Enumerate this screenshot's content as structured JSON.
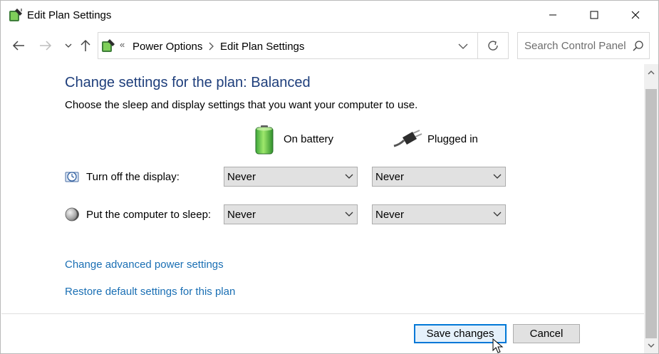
{
  "window": {
    "title": "Edit Plan Settings",
    "icon": "power-options-icon"
  },
  "navigation": {
    "breadcrumb": [
      "Power Options",
      "Edit Plan Settings"
    ],
    "breadcrumb_overflow": "«",
    "search_placeholder": "Search Control Panel"
  },
  "main": {
    "heading": "Change settings for the plan: Balanced",
    "description": "Choose the sleep and display settings that you want your computer to use.",
    "columns": [
      {
        "label": "On battery",
        "icon": "battery-icon"
      },
      {
        "label": "Plugged in",
        "icon": "power-plug-icon"
      }
    ],
    "settings": [
      {
        "label": "Turn off the display:",
        "icon": "display-timer-icon",
        "on_battery": "Never",
        "plugged_in": "Never"
      },
      {
        "label": "Put the computer to sleep:",
        "icon": "sleep-moon-icon",
        "on_battery": "Never",
        "plugged_in": "Never"
      }
    ],
    "links": [
      "Change advanced power settings",
      "Restore default settings for this plan"
    ]
  },
  "footer": {
    "save_label": "Save changes",
    "cancel_label": "Cancel"
  },
  "colors": {
    "heading": "#1e3e7b",
    "link": "#1a6fb4",
    "accent": "#0078d7"
  }
}
